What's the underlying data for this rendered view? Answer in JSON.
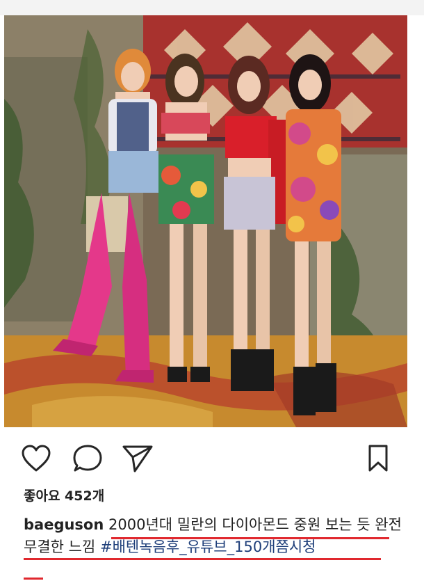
{
  "post": {
    "username": "baeguson",
    "likes_text": "좋아요 452개",
    "caption_text": "2000년대 밀란의 다이아몬드 중원 보는 듯 완전무결한 느낌",
    "hashtags": "#배텐녹음후_유튜브_150개쯤시청"
  },
  "icons": {
    "like": "heart-icon",
    "comment": "comment-bubble-icon",
    "share": "paper-plane-icon",
    "save": "bookmark-icon"
  },
  "colors": {
    "underline": "#e0282e",
    "hashtag": "#1f3f7a"
  }
}
